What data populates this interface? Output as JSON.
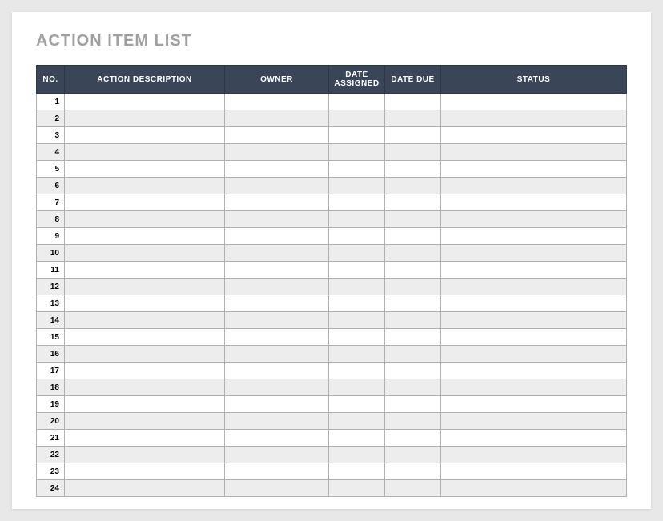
{
  "title": "ACTION ITEM LIST",
  "columns": {
    "no": "NO.",
    "action": "ACTION DESCRIPTION",
    "owner": "OWNER",
    "assigned": "DATE ASSIGNED",
    "due": "DATE DUE",
    "status": "STATUS"
  },
  "rows": [
    {
      "no": "1",
      "action": "",
      "owner": "",
      "assigned": "",
      "due": "",
      "status": ""
    },
    {
      "no": "2",
      "action": "",
      "owner": "",
      "assigned": "",
      "due": "",
      "status": ""
    },
    {
      "no": "3",
      "action": "",
      "owner": "",
      "assigned": "",
      "due": "",
      "status": ""
    },
    {
      "no": "4",
      "action": "",
      "owner": "",
      "assigned": "",
      "due": "",
      "status": ""
    },
    {
      "no": "5",
      "action": "",
      "owner": "",
      "assigned": "",
      "due": "",
      "status": ""
    },
    {
      "no": "6",
      "action": "",
      "owner": "",
      "assigned": "",
      "due": "",
      "status": ""
    },
    {
      "no": "7",
      "action": "",
      "owner": "",
      "assigned": "",
      "due": "",
      "status": ""
    },
    {
      "no": "8",
      "action": "",
      "owner": "",
      "assigned": "",
      "due": "",
      "status": ""
    },
    {
      "no": "9",
      "action": "",
      "owner": "",
      "assigned": "",
      "due": "",
      "status": ""
    },
    {
      "no": "10",
      "action": "",
      "owner": "",
      "assigned": "",
      "due": "",
      "status": ""
    },
    {
      "no": "11",
      "action": "",
      "owner": "",
      "assigned": "",
      "due": "",
      "status": ""
    },
    {
      "no": "12",
      "action": "",
      "owner": "",
      "assigned": "",
      "due": "",
      "status": ""
    },
    {
      "no": "13",
      "action": "",
      "owner": "",
      "assigned": "",
      "due": "",
      "status": ""
    },
    {
      "no": "14",
      "action": "",
      "owner": "",
      "assigned": "",
      "due": "",
      "status": ""
    },
    {
      "no": "15",
      "action": "",
      "owner": "",
      "assigned": "",
      "due": "",
      "status": ""
    },
    {
      "no": "16",
      "action": "",
      "owner": "",
      "assigned": "",
      "due": "",
      "status": ""
    },
    {
      "no": "17",
      "action": "",
      "owner": "",
      "assigned": "",
      "due": "",
      "status": ""
    },
    {
      "no": "18",
      "action": "",
      "owner": "",
      "assigned": "",
      "due": "",
      "status": ""
    },
    {
      "no": "19",
      "action": "",
      "owner": "",
      "assigned": "",
      "due": "",
      "status": ""
    },
    {
      "no": "20",
      "action": "",
      "owner": "",
      "assigned": "",
      "due": "",
      "status": ""
    },
    {
      "no": "21",
      "action": "",
      "owner": "",
      "assigned": "",
      "due": "",
      "status": ""
    },
    {
      "no": "22",
      "action": "",
      "owner": "",
      "assigned": "",
      "due": "",
      "status": ""
    },
    {
      "no": "23",
      "action": "",
      "owner": "",
      "assigned": "",
      "due": "",
      "status": ""
    },
    {
      "no": "24",
      "action": "",
      "owner": "",
      "assigned": "",
      "due": "",
      "status": ""
    }
  ]
}
